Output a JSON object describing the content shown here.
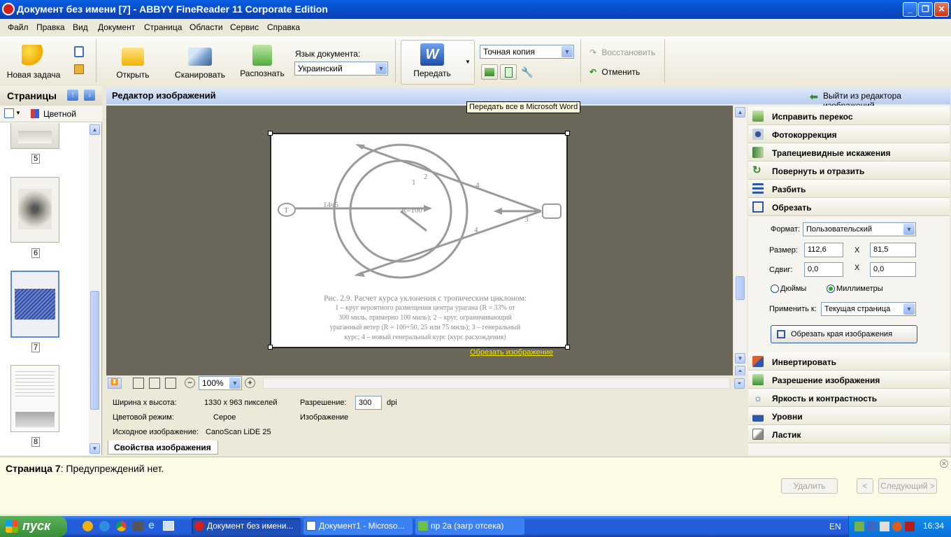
{
  "window": {
    "title": "Документ без имени [7] - ABBYY FineReader 11 Corporate Edition",
    "controls": {
      "minimize": "_",
      "maximize": "❐",
      "close": "✕"
    }
  },
  "menu": [
    "Файл",
    "Правка",
    "Вид",
    "Документ",
    "Страница",
    "Области",
    "Сервис",
    "Справка"
  ],
  "toolbar": {
    "new_task": "Новая задача",
    "open": "Открыть",
    "scan": "Сканировать",
    "recognize": "Распознать",
    "doc_language_label": "Язык документа:",
    "doc_language_value": "Украинский",
    "send": "Передать",
    "send_tooltip": "Передать все в Microsoft Word",
    "copy_mode": "Точная копия",
    "restore": "Восстановить",
    "undo": "Отменить"
  },
  "pages_panel": {
    "title": "Страницы",
    "view_mode": "Цветной",
    "pages": [
      {
        "number": "5"
      },
      {
        "number": "6"
      },
      {
        "number": "7",
        "selected": true
      },
      {
        "number": "8"
      }
    ]
  },
  "editor": {
    "title": "Редактор изображений",
    "exit_label": "Выйти из редактора изображений",
    "crop_link": "Обрезать изображение",
    "image": {
      "caption_lines": [
        "Рис. 2.9. Расчет курса уклонения с тропическим циклоном:",
        "1 – круг вероятного размещения центра урагана (R = 33% от",
        "300 миль, примерно 100 миль); 2 – круг, ограничивающий",
        "ураганный ветер (R = 100+50, 25 или 75 миль); 3 – генеральный",
        "курс; 4 – новый генеральный курс (курс расхождения)"
      ],
      "labels": {
        "t": "T",
        "course": "14ч5",
        "radius": "R=100",
        "n1": "1",
        "n2": "2",
        "n3": "3",
        "n4a": "4",
        "n4b": "4"
      }
    },
    "zoom": "100%"
  },
  "properties": {
    "size_label": "Ширина x высота:",
    "size_value": "1330 x 963 пикселей",
    "resolution_label": "Разрешение:",
    "resolution_value": "300",
    "resolution_unit": "dpi",
    "color_label": "Цветовой режим:",
    "color_value": "Серое",
    "image_label": "Изображение",
    "source_label": "Исходное изображение:",
    "source_value": "CanoScan LiDE 25",
    "tab": "Свойства изображения"
  },
  "right_panel": {
    "tools_top": [
      {
        "label": "Исправить перекос",
        "icon": "skew-icon"
      },
      {
        "label": "Фотокоррекция",
        "icon": "camera-icon"
      },
      {
        "label": "Трапециевидные искажения",
        "icon": "trapezoid-icon"
      },
      {
        "label": "Повернуть и отразить",
        "icon": "rotate-icon"
      },
      {
        "label": "Разбить",
        "icon": "split-icon"
      },
      {
        "label": "Обрезать",
        "icon": "crop-icon"
      }
    ],
    "crop": {
      "format_label": "Формат:",
      "format_value": "Пользовательский",
      "size_label": "Размер:",
      "width": "112,6",
      "x": "X",
      "height": "81,5",
      "offset_label": "Сдвиг:",
      "offset_x": "0,0",
      "offset_y": "0,0",
      "unit_inches": "Дюймы",
      "unit_mm": "Миллиметры",
      "apply_label": "Применить к:",
      "apply_value": "Текущая страница",
      "crop_button": "Обрезать края изображения"
    },
    "tools_bottom": [
      {
        "label": "Инвертировать",
        "icon": "invert-icon"
      },
      {
        "label": "Разрешение изображения",
        "icon": "resolution-icon"
      },
      {
        "label": "Яркость и контрастность",
        "icon": "brightness-icon"
      },
      {
        "label": "Уровни",
        "icon": "levels-icon"
      },
      {
        "label": "Ластик",
        "icon": "eraser-icon"
      }
    ]
  },
  "warning": {
    "page": "Страница 7",
    "message": ": Предупреждений нет.",
    "delete": "Удалить",
    "prev": "<",
    "next": "Следующий >"
  },
  "taskbar": {
    "start": "пуск",
    "tasks": [
      "Документ без имени...",
      "Документ1 - Microso...",
      "пр 2а (загр отсека)"
    ],
    "lang": "EN",
    "clock": "16:34"
  }
}
